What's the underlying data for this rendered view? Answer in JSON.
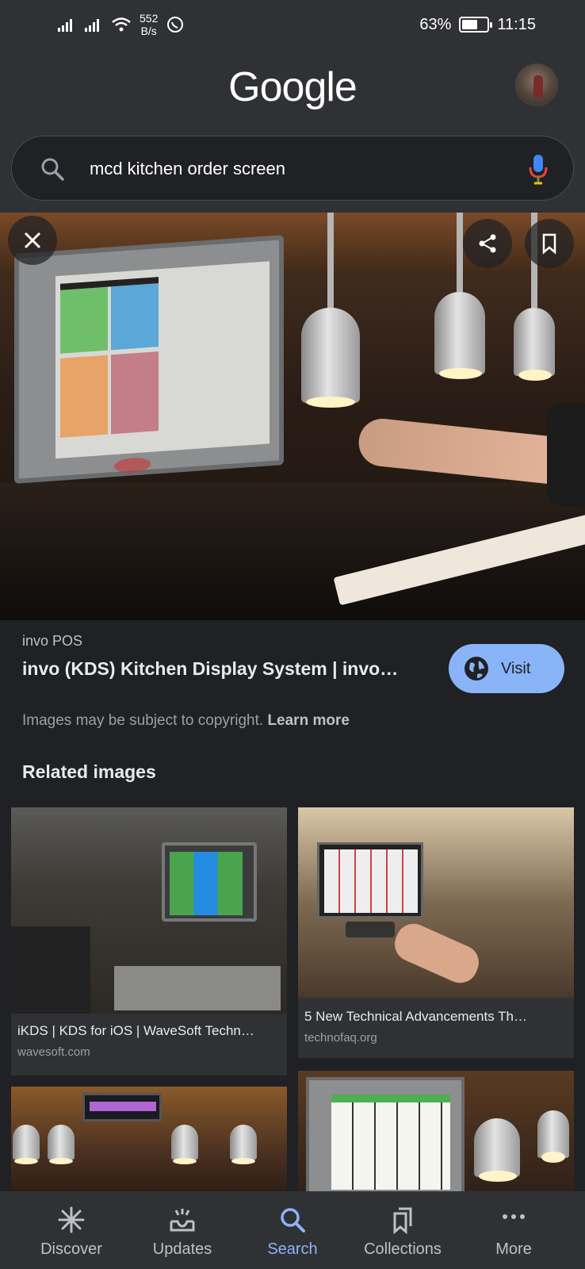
{
  "status_bar": {
    "net_speed_value": "552",
    "net_speed_unit": "B/s",
    "battery_percent": "63%",
    "battery_level": 0.63,
    "time": "11:15"
  },
  "header": {
    "logo_text": "Google"
  },
  "search": {
    "query": "mcd kitchen order screen"
  },
  "result": {
    "source": "invo POS",
    "title": "invo (KDS) Kitchen Display System | invo…",
    "visit_label": "Visit",
    "copyright_text": "Images may be subject to copyright.",
    "learn_more": "Learn more"
  },
  "related": {
    "heading": "Related images",
    "items": [
      {
        "title": "iKDS | KDS for iOS | WaveSoft Techn…",
        "site": "wavesoft.com"
      },
      {
        "title": "5 New Technical Advancements Th…",
        "site": "technofaq.org"
      }
    ]
  },
  "bottom_nav": {
    "items": [
      {
        "label": "Discover",
        "icon": "asterisk-icon"
      },
      {
        "label": "Updates",
        "icon": "inbox-icon"
      },
      {
        "label": "Search",
        "icon": "search-icon"
      },
      {
        "label": "Collections",
        "icon": "bookmarks-icon"
      },
      {
        "label": "More",
        "icon": "more-dots-icon"
      }
    ],
    "active": "Search"
  },
  "colors": {
    "accent": "#8ab4f8",
    "background": "#202124",
    "surface": "#303134"
  }
}
